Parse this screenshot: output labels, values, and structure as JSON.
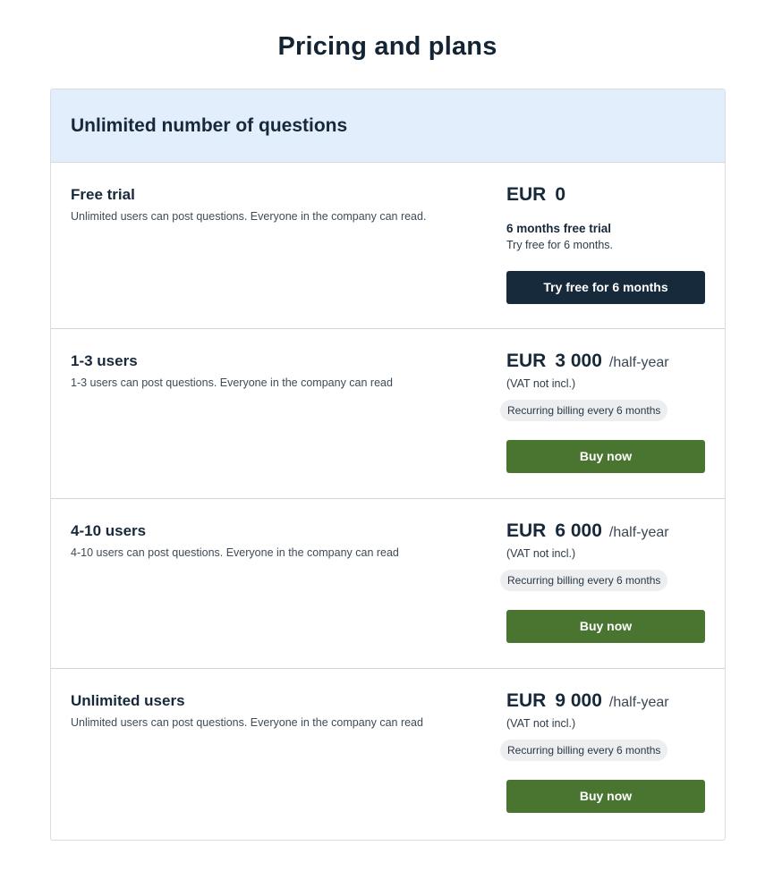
{
  "page": {
    "title": "Pricing and plans"
  },
  "card": {
    "header": "Unlimited number of questions"
  },
  "plans": [
    {
      "name": "Free trial",
      "description": "Unlimited users can post questions. Everyone in the company can read.",
      "currency": "EUR",
      "amount": "0",
      "trial_title": "6 months free trial",
      "trial_subtitle": "Try free for 6 months.",
      "button_label": "Try free for 6 months"
    },
    {
      "name": "1-3 users",
      "description": "1-3 users can post questions. Everyone in the company can read",
      "currency": "EUR",
      "amount": "3 000",
      "period": "/half-year",
      "vat_note": "(VAT not incl.)",
      "billing_badge": "Recurring billing every 6 months",
      "button_label": "Buy now"
    },
    {
      "name": "4-10 users",
      "description": "4-10 users can post questions. Everyone in the company can read",
      "currency": "EUR",
      "amount": "6 000",
      "period": "/half-year",
      "vat_note": "(VAT not incl.)",
      "billing_badge": "Recurring billing every 6 months",
      "button_label": "Buy now"
    },
    {
      "name": "Unlimited users",
      "description": "Unlimited users can post questions. Everyone in the company can read",
      "currency": "EUR",
      "amount": "9 000",
      "period": "/half-year",
      "vat_note": "(VAT not incl.)",
      "billing_badge": "Recurring billing every 6 months",
      "button_label": "Buy now"
    }
  ],
  "colors": {
    "header_bg": "#e2eefc",
    "dark_button": "#172a3b",
    "buy_button": "#4a7530",
    "badge_bg": "#eceef0"
  }
}
